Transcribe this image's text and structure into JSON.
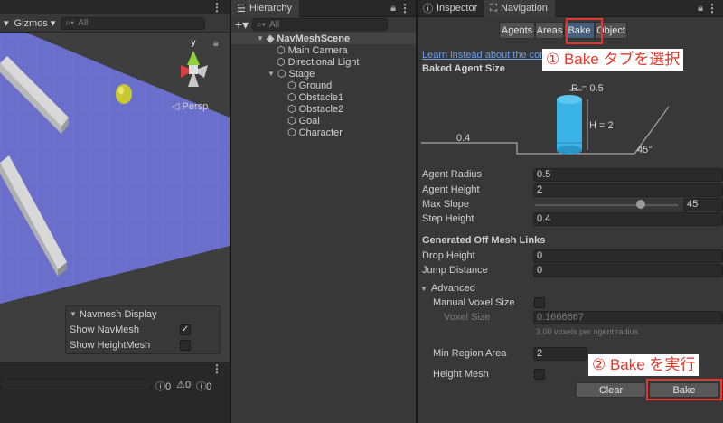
{
  "scene": {
    "gizmos_label": "Gizmos",
    "search_placeholder": "All",
    "persp_label": "◁ Persp",
    "axis_label": "y",
    "navmesh_display": {
      "title": "Navmesh Display",
      "show_navmesh": "Show NavMesh",
      "show_heightmesh": "Show HeightMesh",
      "show_navmesh_checked": true,
      "show_heightmesh_checked": false
    },
    "console": {
      "errors": "0",
      "warnings": "0",
      "logs": "0"
    }
  },
  "hierarchy": {
    "tab_label": "Hierarchy",
    "search_placeholder": "All",
    "scene_name": "NavMeshScene",
    "items": [
      {
        "label": "Main Camera"
      },
      {
        "label": "Directional Light"
      },
      {
        "label": "Stage"
      },
      {
        "label": "Ground"
      },
      {
        "label": "Obstacle1"
      },
      {
        "label": "Obstacle2"
      },
      {
        "label": "Goal"
      },
      {
        "label": "Character"
      }
    ]
  },
  "navigation": {
    "inspector_tab": "Inspector",
    "navigation_tab": "Navigation",
    "subtabs": [
      "Agents",
      "Areas",
      "Bake",
      "Object"
    ],
    "active_subtab": "Bake",
    "learn_link": "Learn instead about the comp",
    "baked_agent_size": "Baked Agent Size",
    "diagram": {
      "radius_label": "R = 0.5",
      "height_label": "H = 2",
      "step_label": "0.4",
      "slope_label": "45°"
    },
    "props": {
      "agent_radius": {
        "label": "Agent Radius",
        "value": "0.5"
      },
      "agent_height": {
        "label": "Agent Height",
        "value": "2"
      },
      "max_slope": {
        "label": "Max Slope",
        "value": "45",
        "slider": 0.75
      },
      "step_height": {
        "label": "Step Height",
        "value": "0.4"
      }
    },
    "offmesh_title": "Generated Off Mesh Links",
    "drop_height": {
      "label": "Drop Height",
      "value": "0"
    },
    "jump_distance": {
      "label": "Jump Distance",
      "value": "0"
    },
    "advanced": "Advanced",
    "manual_voxel_size": "Manual Voxel Size",
    "voxel_size": {
      "label": "Voxel Size",
      "value": "0.1666667"
    },
    "voxel_hint": "3.00 voxels per agent radius",
    "min_region_area": {
      "label": "Min Region Area",
      "value": "2"
    },
    "height_mesh": "Height Mesh",
    "clear_button": "Clear",
    "bake_button": "Bake"
  },
  "annotations": {
    "step1": "① Bake タブを選択",
    "step2": "② Bake を実行",
    "color": "#e8352a"
  }
}
